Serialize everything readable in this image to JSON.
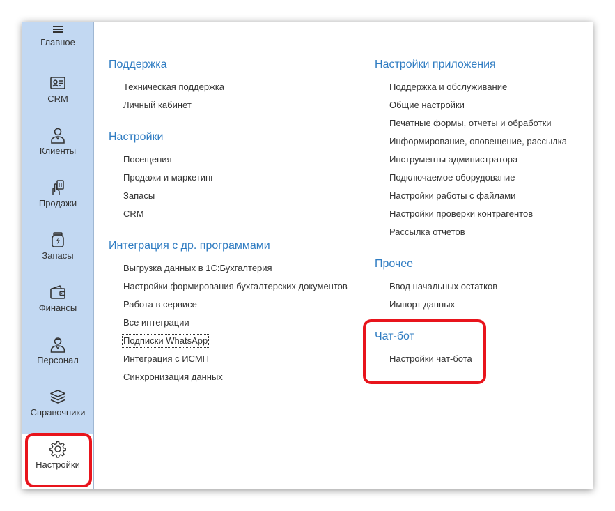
{
  "sidebar": {
    "items": [
      {
        "label": "Главное",
        "icon": "menu-icon"
      },
      {
        "label": "CRM",
        "icon": "contact-card-icon"
      },
      {
        "label": "Клиенты",
        "icon": "client-person-icon"
      },
      {
        "label": "Продажи",
        "icon": "sales-hand-icon"
      },
      {
        "label": "Запасы",
        "icon": "stock-jar-icon"
      },
      {
        "label": "Финансы",
        "icon": "wallet-icon"
      },
      {
        "label": "Персонал",
        "icon": "staff-person-icon"
      },
      {
        "label": "Справочники",
        "icon": "layers-icon"
      },
      {
        "label": "Настройки",
        "icon": "gear-icon"
      }
    ]
  },
  "left_column": {
    "sections": [
      {
        "title": "Поддержка",
        "links": [
          "Техническая поддержка",
          "Личный кабинет"
        ]
      },
      {
        "title": "Настройки",
        "links": [
          "Посещения",
          "Продажи и маркетинг",
          "Запасы",
          "CRM"
        ]
      },
      {
        "title": "Интеграция с др. программами",
        "links": [
          "Выгрузка данных в 1С:Бухгалтерия",
          "Настройки формирования бухгалтерских документов",
          "Работа в сервисе",
          "Все интеграции",
          "Подписки WhatsApp",
          "Интеграция с ИСМП",
          "Синхронизация данных"
        ]
      }
    ]
  },
  "right_column": {
    "sections": [
      {
        "title": "Настройки приложения",
        "links": [
          "Поддержка и обслуживание",
          "Общие настройки",
          "Печатные формы, отчеты и обработки",
          "Информирование, оповещение, рассылка",
          "Инструменты администратора",
          "Подключаемое оборудование",
          "Настройки работы с файлами",
          "Настройки проверки контрагентов",
          "Рассылка отчетов"
        ]
      },
      {
        "title": "Прочее",
        "links": [
          "Ввод начальных остатков",
          "Импорт данных"
        ]
      },
      {
        "title": "Чат-бот",
        "links": [
          "Настройки чат-бота"
        ]
      }
    ]
  },
  "colors": {
    "sidebar_bg": "#c2d8f2",
    "section_title": "#2f7cc2",
    "highlight": "#e8141c",
    "link_text": "#333333"
  }
}
